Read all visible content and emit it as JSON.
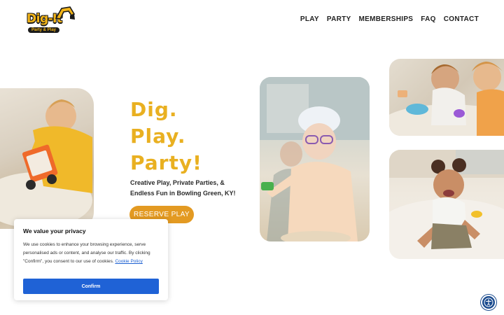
{
  "logo": {
    "title": "Dig-It",
    "subtitle": "Party & Play"
  },
  "nav": {
    "items": [
      {
        "label": "PLAY"
      },
      {
        "label": "PARTY"
      },
      {
        "label": "MEMBERSHIPS"
      },
      {
        "label": "FAQ"
      },
      {
        "label": "CONTACT"
      }
    ]
  },
  "hero": {
    "headline": [
      "Dig.",
      "Play.",
      "Party!"
    ],
    "tagline": "Creative Play, Private Parties, & Endless Fun in Bowling Green, KY!",
    "cta": "RESERVE PLAY"
  },
  "cookie": {
    "title": "We value your privacy",
    "body": "We use cookies to enhance your browsing experience, serve personalised ads or content, and analyse our traffic. By clicking \"Confirm\", you consent to our use of cookies.",
    "link": "Cookie Policy",
    "button": "Confirm"
  },
  "colors": {
    "brand_yellow": "#e9b021",
    "cta_orange": "#e39a22",
    "confirm_blue": "#1f62d6",
    "a11y_navy": "#1c4c8f"
  },
  "icons": {
    "accessibility": "accessibility-icon",
    "excavator": "excavator-icon"
  }
}
